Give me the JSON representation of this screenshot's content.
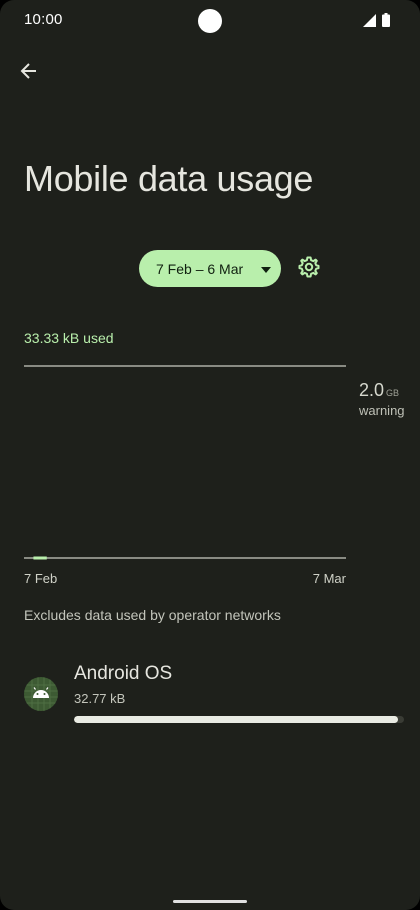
{
  "status_bar": {
    "time": "10:00",
    "signal_icon": "signal-icon",
    "battery_icon": "battery-icon"
  },
  "header": {
    "back_icon": "arrow-back-icon",
    "title": "Mobile data usage"
  },
  "date_range": {
    "label": "7 Feb – 6 Mar",
    "dropdown_icon": "dropdown-arrow-icon",
    "settings_icon": "gear-icon"
  },
  "usage": {
    "summary": "33.33 kB used"
  },
  "chart": {
    "warning_value": "2.0",
    "warning_unit": "GB",
    "warning_label": "warning",
    "x_start_label": "7 Feb",
    "x_end_label": "7 Mar"
  },
  "chart_data": {
    "type": "area",
    "x_labels": [
      "7 Feb",
      "7 Mar"
    ],
    "y_marker": {
      "value": 2.0,
      "unit": "GB",
      "label": "warning"
    },
    "usage_segment": {
      "start_day_index": 1,
      "end_day_index": 2,
      "value_kb": 33.33
    },
    "colors": {
      "usage": "#b9efac",
      "axis": "#c9cbc1",
      "marker": "#9ea096"
    }
  },
  "disclaimer": "Excludes data used by operator networks",
  "apps": [
    {
      "name": "Android OS",
      "usage": "32.77 kB",
      "icon": "android-icon",
      "share_of_total": 0.983
    }
  ],
  "colors": {
    "background": "#1e201b",
    "accent": "#b9efac",
    "text_primary": "#e6e6df",
    "text_secondary": "#c3c5bb"
  }
}
